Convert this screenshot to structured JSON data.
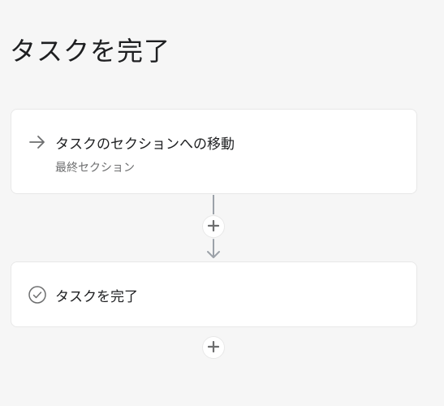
{
  "page": {
    "title": "タスクを完了"
  },
  "steps": [
    {
      "icon": "arrow-right-icon",
      "title": "タスクのセクションへの移動",
      "subtitle": "最終セクション"
    },
    {
      "icon": "check-circle-icon",
      "title": "タスクを完了"
    }
  ],
  "connectors": {
    "add_icon": "plus-icon"
  },
  "colors": {
    "background": "#f6f6f6",
    "card": "#ffffff",
    "connector": "#9ca2a9",
    "text": "#1e1f21",
    "muted_text": "#6d6e6f"
  }
}
